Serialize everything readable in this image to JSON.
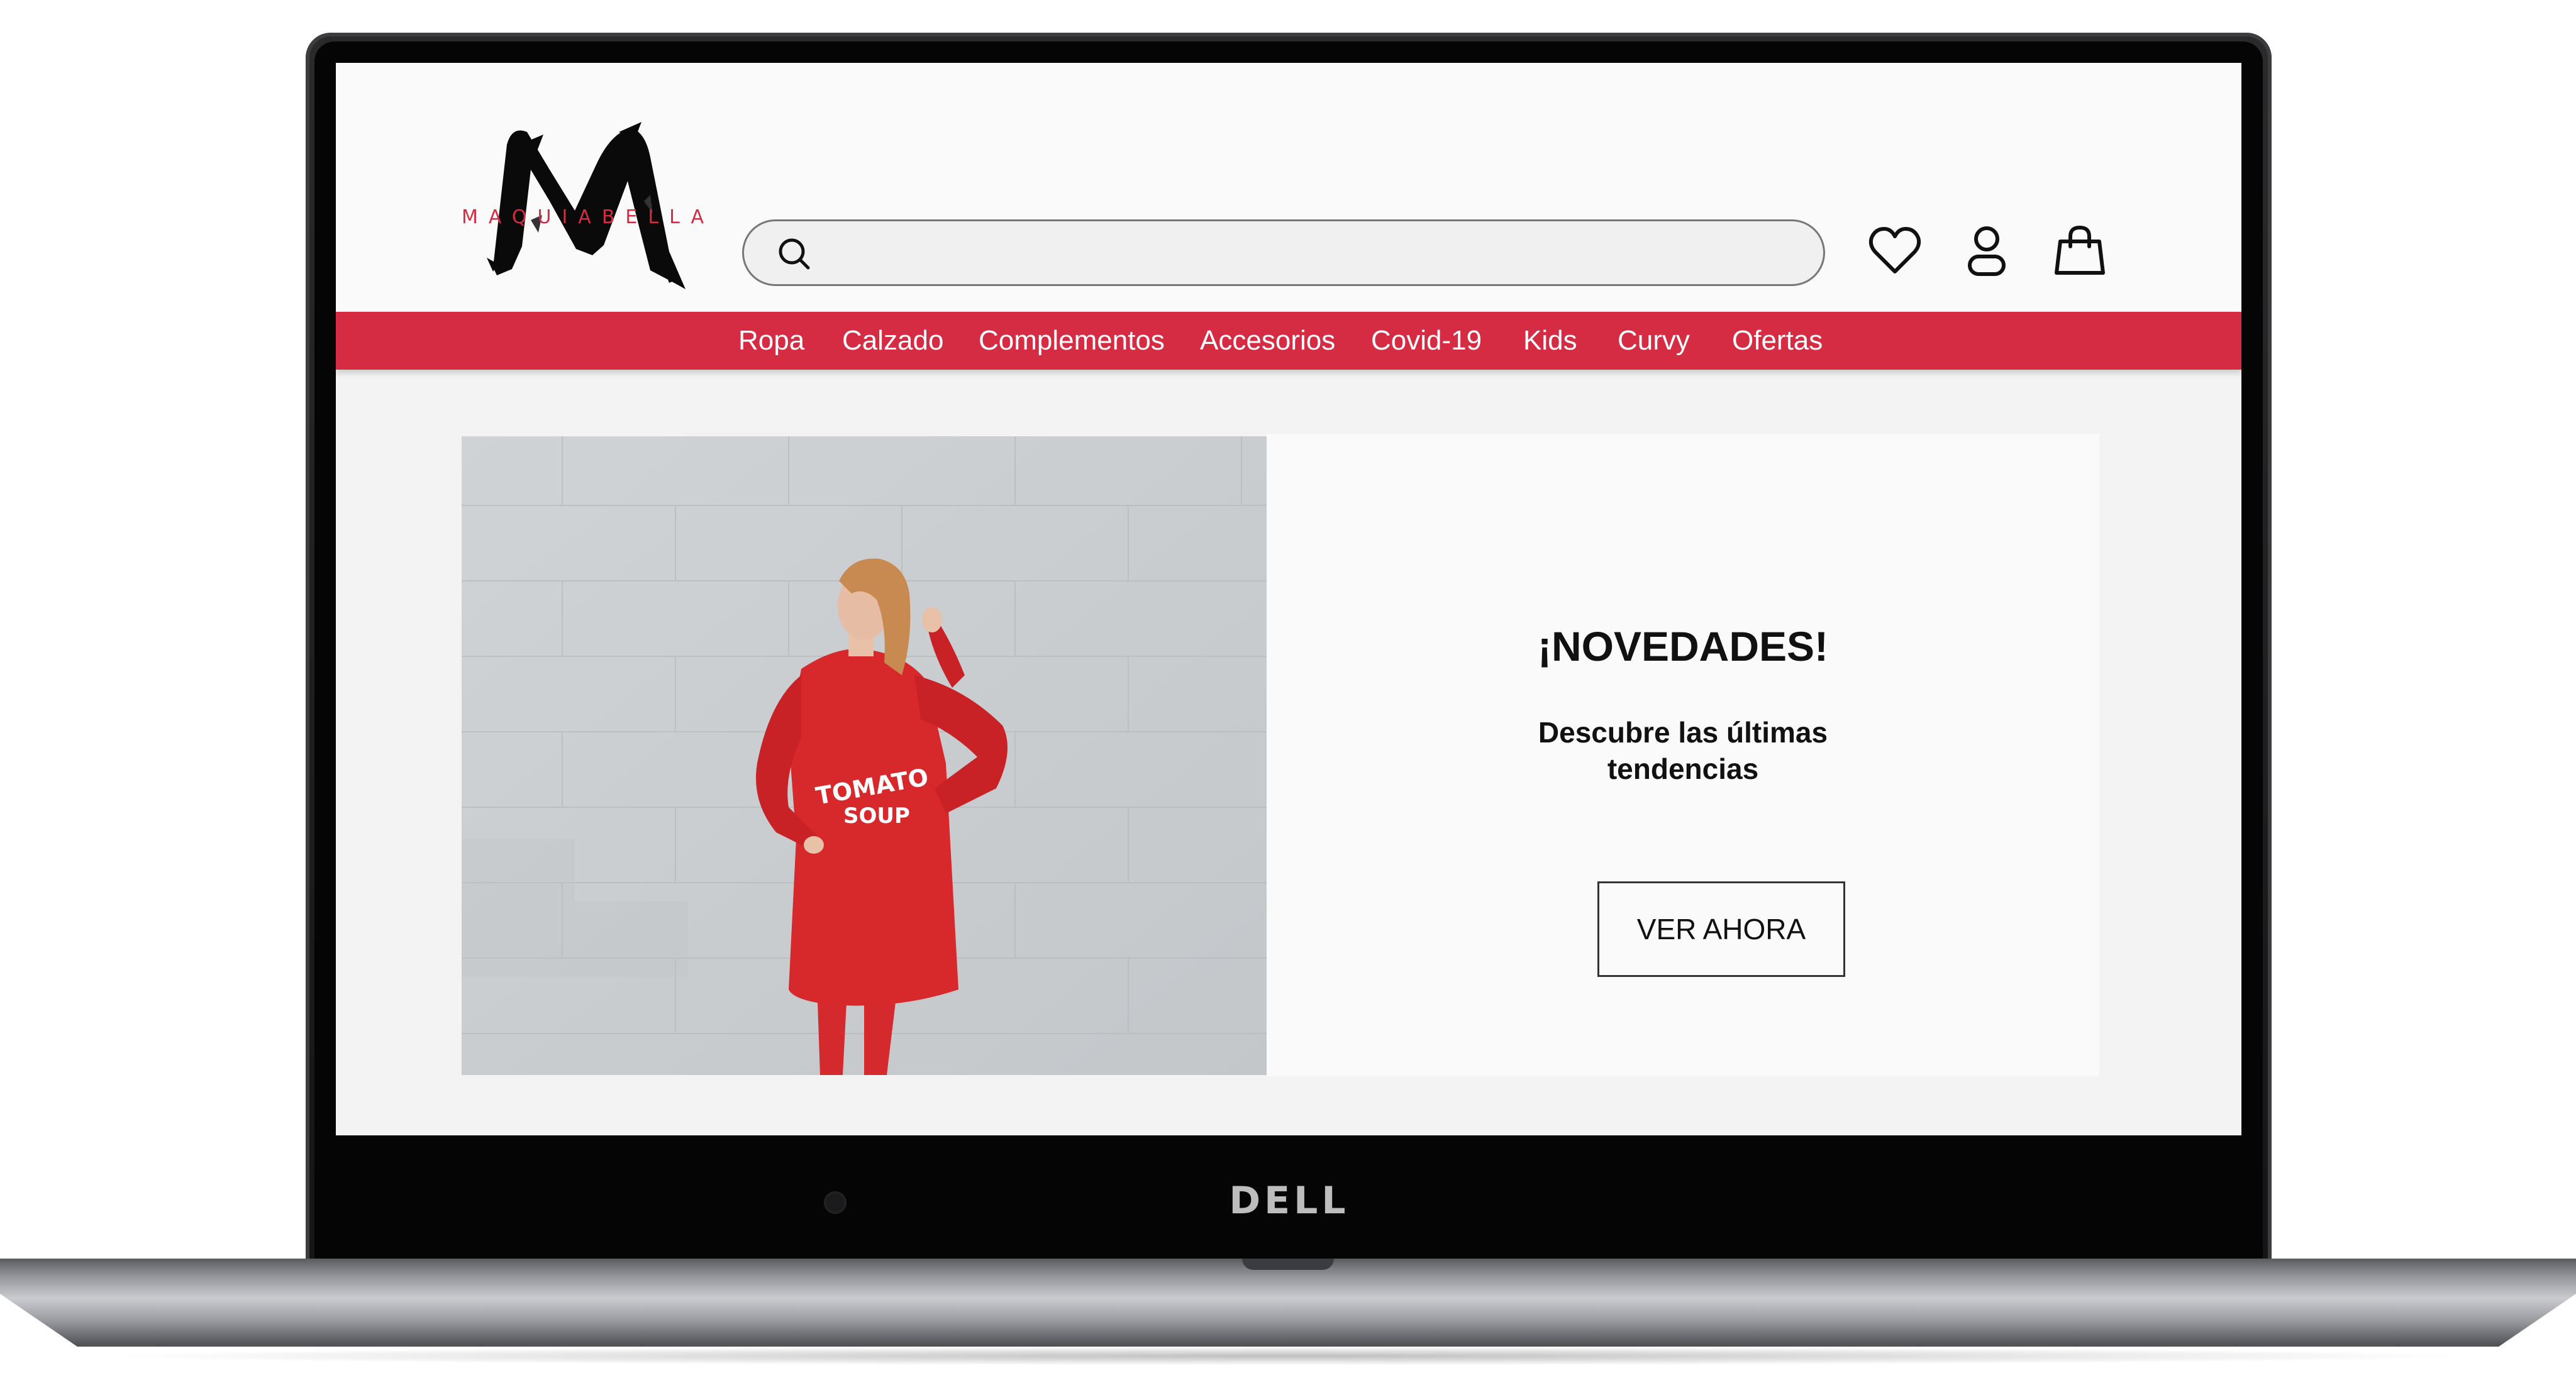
{
  "device": {
    "brand_logo": "DELL"
  },
  "header": {
    "logo_text": "MAQUIABELLA",
    "search": {
      "placeholder": "",
      "value": ""
    },
    "icons": [
      "heart-icon",
      "user-icon",
      "shopping-bag-icon"
    ]
  },
  "nav": {
    "items": [
      {
        "label": "Ropa"
      },
      {
        "label": "Calzado"
      },
      {
        "label": "Complementos"
      },
      {
        "label": "Accesorios"
      },
      {
        "label": "Covid-19"
      },
      {
        "label": "Kids"
      },
      {
        "label": "Curvy"
      },
      {
        "label": "Ofertas"
      }
    ]
  },
  "hero": {
    "title": "¡NOVEDADES!",
    "subtitle": "Descubre las últimas tendencias",
    "button_label": "VER AHORA",
    "shirt_text_line1": "TOMATO",
    "shirt_text_line2": "SOUP"
  },
  "colors": {
    "brand": "#d52b43",
    "header_bg": "#fafafa",
    "page_bg": "#f3f3f3",
    "text": "#111111"
  }
}
